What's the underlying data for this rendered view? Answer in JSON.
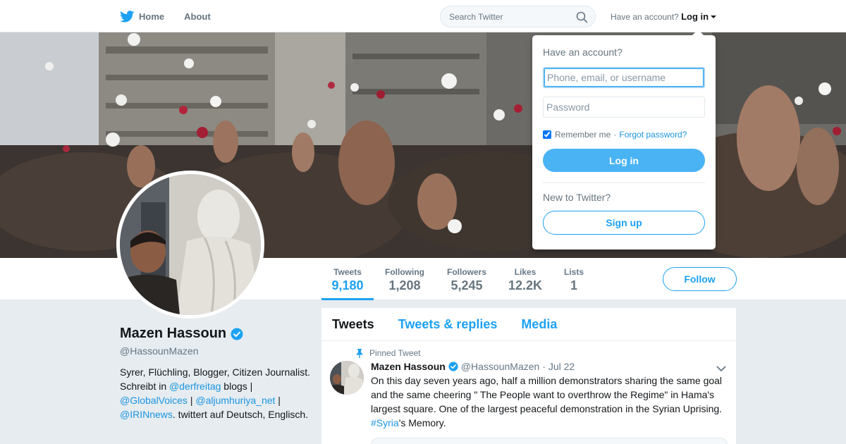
{
  "nav": {
    "home_label": "Home",
    "about_label": "About",
    "search_placeholder": "Search Twitter",
    "have_account": "Have an account?",
    "login_label": "Log in"
  },
  "stats": [
    {
      "label": "Tweets",
      "value": "9,180"
    },
    {
      "label": "Following",
      "value": "1,208"
    },
    {
      "label": "Followers",
      "value": "5,245"
    },
    {
      "label": "Likes",
      "value": "12.2K"
    },
    {
      "label": "Lists",
      "value": "1"
    }
  ],
  "follow_label": "Follow",
  "profile": {
    "name": "Mazen Hassoun",
    "handle": "@HassounMazen",
    "bio_1": "Syrer, Flüchling, Blogger, Citizen Journalist. Schreibt in ",
    "bio_link_1": "@derfreitag",
    "bio_2": " blogs | ",
    "bio_link_2": "@GlobalVoices",
    "bio_3": " | ",
    "bio_link_3": "@aljumhuriya_net",
    "bio_4": " | ",
    "bio_link_4": "@IRINnews",
    "bio_5": ". twittert auf Deutsch, Englisch."
  },
  "timeline": {
    "tabs": [
      "Tweets",
      "Tweets & replies",
      "Media"
    ],
    "pinned_label": "Pinned Tweet",
    "tweet": {
      "name": "Mazen Hassoun",
      "handle": "@HassounMazen",
      "date": "· Jul 22",
      "text": "On this day seven years ago, half a million demonstrators sharing the same goal and the same cheering \" The People want to overthrow the Regime\" in Hama's largest square. One of the largest peaceful demonstration in the Syrian Uprising. ",
      "hashtag": "#Syria",
      "text_end": "'s Memory."
    }
  },
  "login_dropdown": {
    "title": "Have an account?",
    "username_placeholder": "Phone, email, or username",
    "password_placeholder": "Password",
    "remember_label": "Remember me",
    "separator": "·",
    "forgot_label": "Forgot password?",
    "login_button": "Log in",
    "new_label": "New to Twitter?",
    "signup_button": "Sign up"
  },
  "colors": {
    "brand": "#1da1f2",
    "link": "#1b95e0",
    "login_button": "#4ab3f4"
  }
}
